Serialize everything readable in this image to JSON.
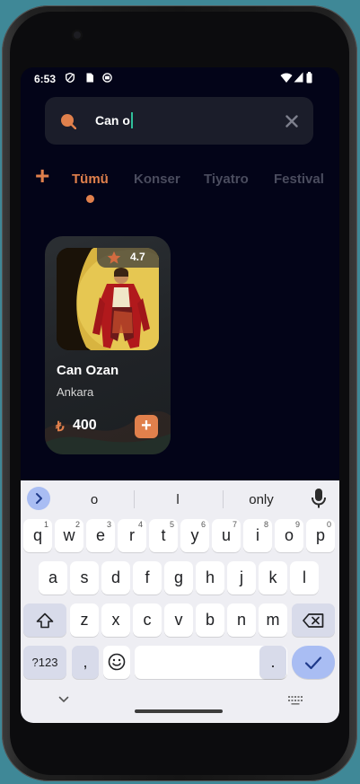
{
  "status_bar": {
    "time": "6:53"
  },
  "search": {
    "query": "Can o"
  },
  "tabs": [
    {
      "label": "Tümü"
    },
    {
      "label": "Konser"
    },
    {
      "label": "Tiyatro"
    },
    {
      "label": "Festival"
    }
  ],
  "card": {
    "rating": "4.7",
    "title": "Can Ozan",
    "location": "Ankara",
    "currency": "₺",
    "price": "400",
    "add_label": "+"
  },
  "keyboard": {
    "suggestions": [
      "o",
      "l",
      "only"
    ],
    "row1": [
      {
        "k": "q",
        "n": "1"
      },
      {
        "k": "w",
        "n": "2"
      },
      {
        "k": "e",
        "n": "3"
      },
      {
        "k": "r",
        "n": "4"
      },
      {
        "k": "t",
        "n": "5"
      },
      {
        "k": "y",
        "n": "6"
      },
      {
        "k": "u",
        "n": "7"
      },
      {
        "k": "i",
        "n": "8"
      },
      {
        "k": "o",
        "n": "9"
      },
      {
        "k": "p",
        "n": "0"
      }
    ],
    "row2": [
      "a",
      "s",
      "d",
      "f",
      "g",
      "h",
      "j",
      "k",
      "l"
    ],
    "row3": [
      "z",
      "x",
      "c",
      "v",
      "b",
      "n",
      "m"
    ],
    "symbols_label": "?123",
    "comma_label": ",",
    "period_label": "."
  },
  "colors": {
    "accent": "#e0804c",
    "screen_bg": "#030418",
    "keyboard_bg": "#eeeef3",
    "key_blue": "#a9bdf3"
  }
}
